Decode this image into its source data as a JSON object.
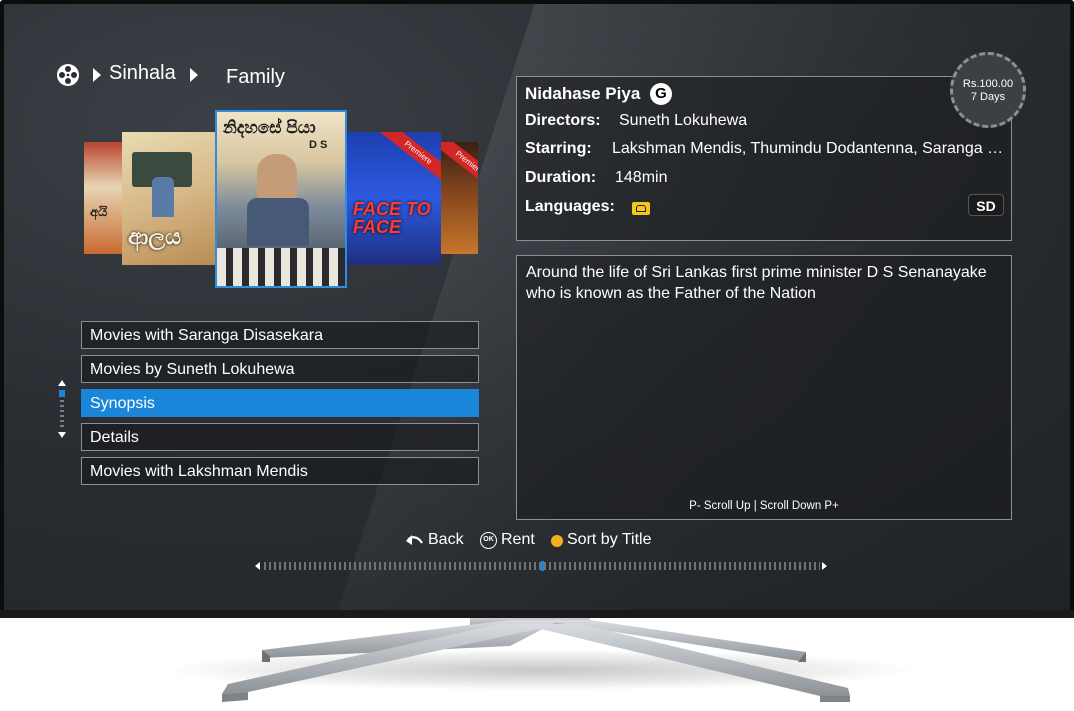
{
  "breadcrumb": {
    "root": "Sinhala",
    "current": "Family"
  },
  "posters": [
    {
      "title": "අයි"
    },
    {
      "title": "ආලය"
    },
    {
      "title": "නිදහසේ පියා",
      "subtitle": "D S"
    },
    {
      "title": "FACE TO FACE",
      "ribbon": "Premiere"
    },
    {
      "title": "",
      "ribbon": "Premiere"
    }
  ],
  "menu": {
    "items": [
      {
        "label": "Movies with Saranga Disasekara"
      },
      {
        "label": "Movies by Suneth Lokuhewa"
      },
      {
        "label": "Synopsis"
      },
      {
        "label": "Details"
      },
      {
        "label": "Movies with Lakshman Mendis"
      }
    ],
    "selected_index": 2
  },
  "details": {
    "title": "Nidahase Piya",
    "rating": "G",
    "directors_label": "Directors:",
    "directors": "Suneth Lokuhewa",
    "starring_label": "Starring:",
    "starring": "Lakshman Mendis, Thumindu Dodantenna, Saranga Disasekara",
    "duration_label": "Duration:",
    "duration": "148min",
    "languages_label": "Languages:",
    "language_icon": "sinhala-language-icon",
    "quality": "SD"
  },
  "price": {
    "amount": "Rs.100.00",
    "period": "7 Days"
  },
  "synopsis": {
    "text": "Around the life of Sri Lankas first prime minister D S Senanayake who is known as the Father of the Nation",
    "scroll_hint": "P- Scroll Up | Scroll Down P+"
  },
  "bottom_nav": {
    "back": "Back",
    "ok_icon": "OK",
    "rent": "Rent",
    "sort": "Sort by Title"
  },
  "timeline": {
    "position": 0.5
  },
  "colors": {
    "accent": "#1a86d9",
    "sort_dot": "#f4b022",
    "screen_bg": "#2a2e33"
  }
}
